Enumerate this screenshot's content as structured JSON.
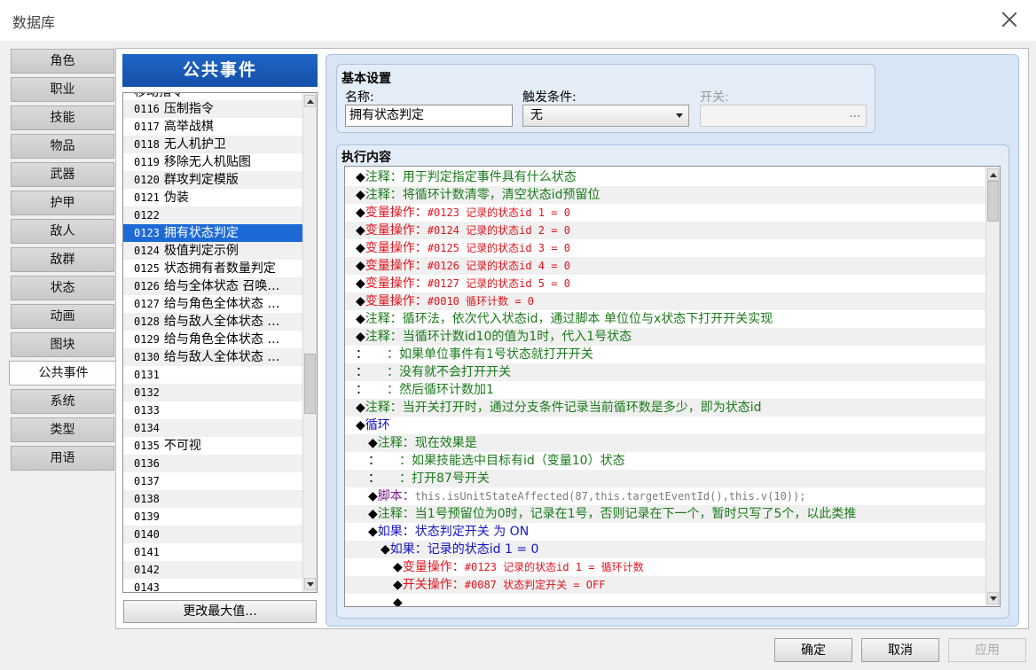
{
  "window": {
    "title": "数据库"
  },
  "tabs": [
    {
      "label": "角色",
      "active": false
    },
    {
      "label": "职业",
      "active": false
    },
    {
      "label": "技能",
      "active": false
    },
    {
      "label": "物品",
      "active": false
    },
    {
      "label": "武器",
      "active": false
    },
    {
      "label": "护甲",
      "active": false
    },
    {
      "label": "敌人",
      "active": false
    },
    {
      "label": "敌群",
      "active": false
    },
    {
      "label": "状态",
      "active": false
    },
    {
      "label": "动画",
      "active": false
    },
    {
      "label": "图块",
      "active": false
    },
    {
      "label": "公共事件",
      "active": true
    },
    {
      "label": "系统",
      "active": false
    },
    {
      "label": "类型",
      "active": false
    },
    {
      "label": "用语",
      "active": false
    }
  ],
  "event_list": {
    "header": "公共事件",
    "top_partial": "移动指令",
    "items": [
      {
        "id": "0116",
        "name": "压制指令"
      },
      {
        "id": "0117",
        "name": "高举战棋"
      },
      {
        "id": "0118",
        "name": "无人机护卫"
      },
      {
        "id": "0119",
        "name": "移除无人机贴图"
      },
      {
        "id": "0120",
        "name": "群攻判定模版"
      },
      {
        "id": "0121",
        "name": "伪装"
      },
      {
        "id": "0122",
        "name": ""
      },
      {
        "id": "0123",
        "name": "拥有状态判定",
        "selected": true
      },
      {
        "id": "0124",
        "name": "极值判定示例"
      },
      {
        "id": "0125",
        "name": "状态拥有者数量判定"
      },
      {
        "id": "0126",
        "name": "给与全体状态 召唤…"
      },
      {
        "id": "0127",
        "name": "给与角色全体状态 …"
      },
      {
        "id": "0128",
        "name": "给与敌人全体状态 …"
      },
      {
        "id": "0129",
        "name": "给与角色全体状态 …"
      },
      {
        "id": "0130",
        "name": "给与敌人全体状态 …"
      },
      {
        "id": "0131",
        "name": ""
      },
      {
        "id": "0132",
        "name": ""
      },
      {
        "id": "0133",
        "name": ""
      },
      {
        "id": "0134",
        "name": ""
      },
      {
        "id": "0135",
        "name": "不可视"
      },
      {
        "id": "0136",
        "name": ""
      },
      {
        "id": "0137",
        "name": ""
      },
      {
        "id": "0138",
        "name": ""
      },
      {
        "id": "0139",
        "name": ""
      },
      {
        "id": "0140",
        "name": ""
      },
      {
        "id": "0141",
        "name": ""
      },
      {
        "id": "0142",
        "name": ""
      },
      {
        "id": "0143",
        "name": ""
      }
    ],
    "scroll_fraction": 0.6,
    "change_max_label": "更改最大值..."
  },
  "basic": {
    "title": "基本设置",
    "name_label": "名称:",
    "name_value": "拥有状态判定",
    "trigger_label": "触发条件:",
    "trigger_value": "无",
    "switch_label": "开关:",
    "switch_button": "..."
  },
  "exec": {
    "title": "执行内容",
    "commands": [
      {
        "indent": 1,
        "marker": "◆",
        "parts": [
          {
            "t": "注释：用于判定指定事件具有什么状态",
            "c": "#1a7a1a"
          }
        ]
      },
      {
        "indent": 1,
        "marker": "◆",
        "parts": [
          {
            "t": "注释：将循环计数清零，清空状态id预留位",
            "c": "#1a7a1a"
          }
        ]
      },
      {
        "indent": 1,
        "marker": "◆",
        "parts": [
          {
            "t": "变量操作：",
            "c": "#e0141e"
          },
          {
            "t": "#0123 记录的状态id 1 = 0",
            "c": "#e0141e",
            "mono": true
          }
        ]
      },
      {
        "indent": 1,
        "marker": "◆",
        "parts": [
          {
            "t": "变量操作：",
            "c": "#e0141e"
          },
          {
            "t": "#0124 记录的状态id 2 = 0",
            "c": "#e0141e",
            "mono": true
          }
        ]
      },
      {
        "indent": 1,
        "marker": "◆",
        "parts": [
          {
            "t": "变量操作：",
            "c": "#e0141e"
          },
          {
            "t": "#0125 记录的状态id 3 = 0",
            "c": "#e0141e",
            "mono": true
          }
        ]
      },
      {
        "indent": 1,
        "marker": "◆",
        "parts": [
          {
            "t": "变量操作：",
            "c": "#e0141e"
          },
          {
            "t": "#0126 记录的状态id 4 = 0",
            "c": "#e0141e",
            "mono": true
          }
        ]
      },
      {
        "indent": 1,
        "marker": "◆",
        "parts": [
          {
            "t": "变量操作：",
            "c": "#e0141e"
          },
          {
            "t": "#0127 记录的状态id 5 = 0",
            "c": "#e0141e",
            "mono": true
          }
        ]
      },
      {
        "indent": 1,
        "marker": "◆",
        "parts": [
          {
            "t": "变量操作：",
            "c": "#e0141e"
          },
          {
            "t": "#0010 循环计数 = 0",
            "c": "#e0141e",
            "mono": true
          }
        ]
      },
      {
        "indent": 1,
        "marker": "◆",
        "parts": [
          {
            "t": "注释：循环法，依次代入状态id，通过脚本 单位位与x状态下打开开关实现",
            "c": "#1a7a1a"
          }
        ]
      },
      {
        "indent": 1,
        "marker": "◆",
        "parts": [
          {
            "t": "注释：当循环计数id10的值为1时，代入1号状态",
            "c": "#1a7a1a"
          }
        ]
      },
      {
        "indent": 1,
        "marker": "：",
        "parts": [
          {
            "t": "　　：如果单位事件有1号状态就打开开关",
            "c": "#1a7a1a"
          }
        ]
      },
      {
        "indent": 1,
        "marker": "：",
        "parts": [
          {
            "t": "　　：没有就不会打开开关",
            "c": "#1a7a1a"
          }
        ]
      },
      {
        "indent": 1,
        "marker": "：",
        "parts": [
          {
            "t": "　　：然后循环计数加1",
            "c": "#1a7a1a"
          }
        ]
      },
      {
        "indent": 1,
        "marker": "◆",
        "parts": [
          {
            "t": "注释：当开关打开时，通过分支条件记录当前循环数是多少，即为状态id",
            "c": "#1a7a1a"
          }
        ]
      },
      {
        "indent": 1,
        "marker": "◆",
        "parts": [
          {
            "t": "循环",
            "c": "#1414c8"
          }
        ]
      },
      {
        "indent": 2,
        "marker": "◆",
        "parts": [
          {
            "t": "注释：现在效果是",
            "c": "#1a7a1a"
          }
        ]
      },
      {
        "indent": 2,
        "marker": "：",
        "parts": [
          {
            "t": "　　：如果技能选中目标有id（变量10）状态",
            "c": "#1a7a1a"
          }
        ]
      },
      {
        "indent": 2,
        "marker": "：",
        "parts": [
          {
            "t": "　　：打开87号开关",
            "c": "#1a7a1a"
          }
        ]
      },
      {
        "indent": 2,
        "marker": "◆",
        "parts": [
          {
            "t": "脚本：",
            "c": "#7a1a8c"
          },
          {
            "t": "this.isUnitStateAffected(87,this.targetEventId(),this.v(10));",
            "c": "#7a7a7a",
            "mono": true
          }
        ]
      },
      {
        "indent": 2,
        "marker": "◆",
        "parts": [
          {
            "t": "注释：当1号预留位为0时，记录在1号，否则记录在下一个，暂时只写了5个，以此类推",
            "c": "#1a7a1a"
          }
        ]
      },
      {
        "indent": 2,
        "marker": "◆",
        "parts": [
          {
            "t": "如果：状态判定开关 为 ON",
            "c": "#1414c8"
          }
        ]
      },
      {
        "indent": 3,
        "marker": "◆",
        "parts": [
          {
            "t": "如果：记录的状态id 1 = 0",
            "c": "#1414c8"
          }
        ]
      },
      {
        "indent": 4,
        "marker": "◆",
        "parts": [
          {
            "t": "变量操作：",
            "c": "#e0141e"
          },
          {
            "t": "#0123 记录的状态id 1 = 循环计数",
            "c": "#e0141e",
            "mono": true
          }
        ]
      },
      {
        "indent": 4,
        "marker": "◆",
        "parts": [
          {
            "t": "开关操作：",
            "c": "#e0141e"
          },
          {
            "t": "#0087 状态判定开关 = OFF",
            "c": "#e0141e",
            "mono": true
          }
        ]
      },
      {
        "indent": 4,
        "marker": "◆",
        "parts": []
      }
    ],
    "scroll_fraction": 0.0
  },
  "footer": {
    "ok": "确定",
    "cancel": "取消",
    "apply": "应用"
  }
}
